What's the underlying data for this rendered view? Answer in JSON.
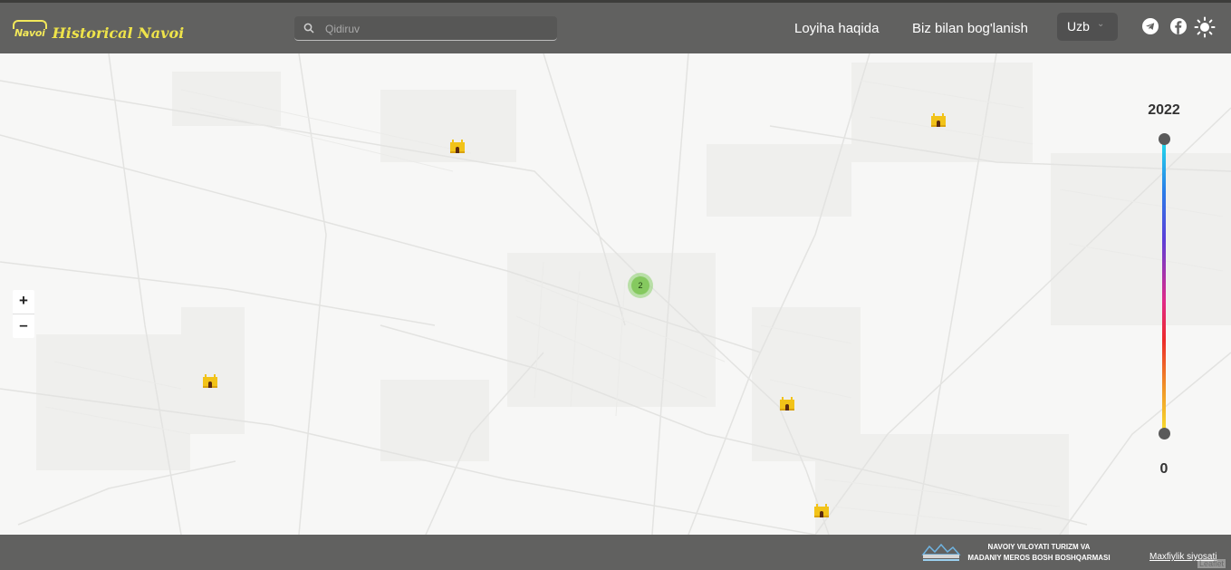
{
  "header": {
    "logo_mark": "Navoi",
    "logo_text": "Historical Navoi",
    "search_placeholder": "Qidiruv",
    "nav": [
      "Loyiha haqida",
      "Biz bilan bog'lanish"
    ],
    "language": "Uzb",
    "icons": [
      "telegram-icon",
      "facebook-icon",
      "sun-icon"
    ]
  },
  "map": {
    "zoom_in": "+",
    "zoom_out": "–",
    "cluster_count": "2",
    "marker_icon": "monument-gate-icon",
    "marker_color": "#f2c318"
  },
  "timeline": {
    "max_label": "2022",
    "min_label": "0",
    "max_value": 2022,
    "min_value": 0,
    "selected_range": [
      0,
      2022
    ]
  },
  "footer": {
    "org_line1": "NAVOIY VILOYATI TURIZM VA",
    "org_line2": "MADANIY MEROS BOSH BOSHQARMASI",
    "privacy": "Maxfiylik siyosati",
    "attribution": "Leaflet"
  },
  "colors": {
    "header_bg": "#616160",
    "brand_yellow": "#eee34a",
    "cluster_green": "#85c95f",
    "map_bg": "#f7f7f6"
  }
}
